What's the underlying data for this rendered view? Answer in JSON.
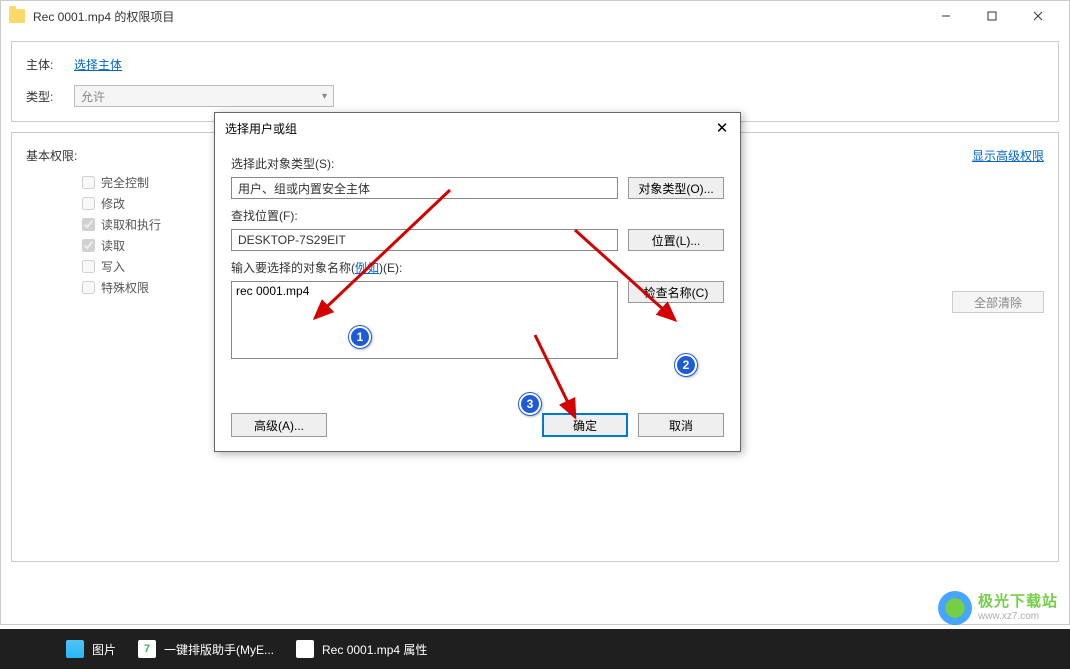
{
  "mainWindow": {
    "title": "Rec 0001.mp4 的权限项目",
    "principalLabel": "主体:",
    "principalLink": "选择主体",
    "typeLabel": "类型:",
    "typeValue": "允许",
    "basicPermLabel": "基本权限:",
    "showAdvancedLabel": "显示高级权限",
    "clearAllLabel": "全部清除",
    "permissions": [
      {
        "label": "完全控制",
        "checked": false,
        "disabled": true
      },
      {
        "label": "修改",
        "checked": false,
        "disabled": true
      },
      {
        "label": "读取和执行",
        "checked": true,
        "disabled": true
      },
      {
        "label": "读取",
        "checked": true,
        "disabled": true
      },
      {
        "label": "写入",
        "checked": false,
        "disabled": true
      },
      {
        "label": "特殊权限",
        "checked": false,
        "disabled": true
      }
    ]
  },
  "dialog": {
    "title": "选择用户或组",
    "objTypeLabel": "选择此对象类型(S):",
    "objTypeValue": "用户、组或内置安全主体",
    "objTypeBtn": "对象类型(O)...",
    "locationLabel": "查找位置(F):",
    "locationValue": "DESKTOP-7S29EIT",
    "locationBtn": "位置(L)...",
    "nameLabel_prefix": "输入要选择的对象名称(",
    "nameLabel_link": "例如",
    "nameLabel_suffix": ")(E):",
    "nameValue": "rec 0001.mp4",
    "checkNameBtn": "检查名称(C)",
    "advancedBtn": "高级(A)...",
    "okBtn": "确定",
    "cancelBtn": "取消"
  },
  "taskbar": {
    "items": [
      {
        "label": "图片",
        "icon": "pictures-icon"
      },
      {
        "label": "一键排版助手(MyE...",
        "icon": "myeditor-icon"
      },
      {
        "label": "Rec 0001.mp4 属性",
        "icon": "properties-icon"
      }
    ]
  },
  "watermark": {
    "line1": "极光下载站",
    "line2": "www.xz7.com"
  },
  "badges": {
    "b1": "1",
    "b2": "2",
    "b3": "3"
  }
}
